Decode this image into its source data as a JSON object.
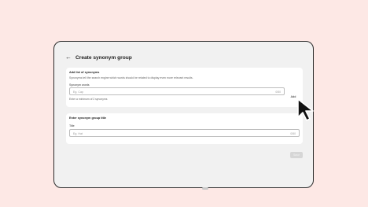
{
  "header": {
    "back_icon": "arrow-left-icon",
    "title": "Create synonym group"
  },
  "list_card": {
    "title": "Add list of synonyms",
    "description": "Synonyms tell the search engine which words should be related to display even more relevant results.",
    "field_label": "Synonym words",
    "placeholder": "Eg. Cap",
    "counter": "0/50",
    "add_label": "Add",
    "help_text": "Enter a minimum of 2 synonyms"
  },
  "title_card": {
    "title": "Enter synonym group title",
    "field_label": "Title",
    "placeholder": "Eg. Hat",
    "counter": "0/50"
  },
  "footer": {
    "save_label": "Save"
  },
  "colors": {
    "background": "#fde8e5",
    "panel": "#f1f1f1",
    "card": "#ffffff",
    "disabled_button": "#d6d6d6"
  }
}
